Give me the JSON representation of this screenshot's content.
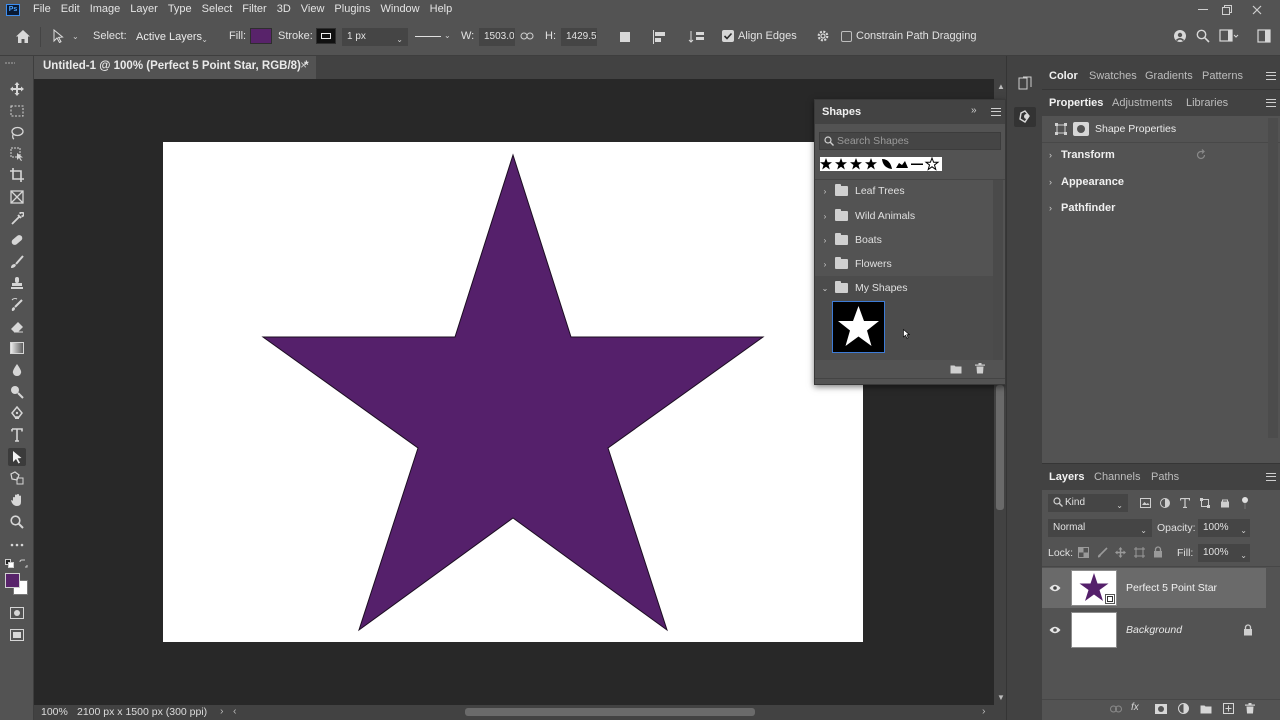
{
  "menubar": {
    "app_icon": "Ps",
    "items": [
      "File",
      "Edit",
      "Image",
      "Layer",
      "Type",
      "Select",
      "Filter",
      "3D",
      "View",
      "Plugins",
      "Window",
      "Help"
    ]
  },
  "options": {
    "select_label": "Select:",
    "select_value": "Active Layers",
    "fill_label": "Fill:",
    "stroke_label": "Stroke:",
    "stroke_width": "1 px",
    "w_label": "W:",
    "w_value": "1503.0",
    "h_label": "H:",
    "h_value": "1429.5",
    "align_edges_label": "Align Edges",
    "align_edges_checked": true,
    "constrain_label": "Constrain Path Dragging",
    "constrain_checked": false,
    "fill_color": "#58236a"
  },
  "document": {
    "tab_title": "Untitled-1 @ 100% (Perfect 5 Point Star, RGB/8) *",
    "tab_close": "×",
    "star_color": "#55206b"
  },
  "status": {
    "zoom": "100%",
    "doc_info": "2100 px x 1500 px (300 ppi)"
  },
  "shapes_panel": {
    "title": "Shapes",
    "search_placeholder": "Search Shapes",
    "groups": [
      {
        "label": "Leaf Trees",
        "expanded": false
      },
      {
        "label": "Wild Animals",
        "expanded": false
      },
      {
        "label": "Boats",
        "expanded": false
      },
      {
        "label": "Flowers",
        "expanded": false
      },
      {
        "label": "My Shapes",
        "expanded": true
      }
    ]
  },
  "color_panel": {
    "tabs": [
      "Color",
      "Swatches",
      "Gradients",
      "Patterns"
    ],
    "active": "Color"
  },
  "properties_panel": {
    "tabs": [
      "Properties",
      "Adjustments",
      "Libraries"
    ],
    "active": "Properties",
    "header": "Shape Properties",
    "sections": [
      "Transform",
      "Appearance",
      "Pathfinder"
    ]
  },
  "layers_panel": {
    "tabs": [
      "Layers",
      "Channels",
      "Paths"
    ],
    "active": "Layers",
    "filter_kind": "Kind",
    "blend_mode": "Normal",
    "opacity_label": "Opacity:",
    "opacity_value": "100%",
    "lock_label": "Lock:",
    "fill_label": "Fill:",
    "fill_value": "100%",
    "layers": [
      {
        "name": "Perfect 5 Point Star",
        "selected": true
      },
      {
        "name": "Background",
        "locked": true
      }
    ]
  },
  "colors": {
    "foreground": "#58236a",
    "background": "#ffffff"
  }
}
